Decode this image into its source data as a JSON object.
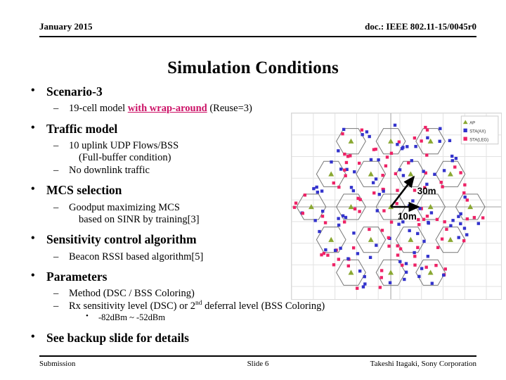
{
  "header": {
    "left": "January 2015",
    "right": "doc.: IEEE 802.11-15/0045r0"
  },
  "title": "Simulation Conditions",
  "bullets": {
    "scenario": {
      "heading": "Scenario-3",
      "sub_prefix": "19-cell model ",
      "sub_highlight": "with wrap-around",
      "sub_suffix": " (Reuse=3)"
    },
    "traffic": {
      "heading": "Traffic model",
      "sub1": "10 uplink UDP Flows/BSS",
      "sub1_cont": "(Full-buffer condition)",
      "sub2": "No downlink traffic"
    },
    "mcs": {
      "heading": "MCS selection",
      "sub1": "Goodput maximizing MCS",
      "sub1_cont": "based on SINR by training[3]"
    },
    "sensitivity": {
      "heading": "Sensitivity control algorithm",
      "sub1": "Beacon RSSI based algorithm[5]"
    },
    "parameters": {
      "heading": "Parameters",
      "sub1": "Method (DSC / BSS Coloring)",
      "sub2_a": "Rx sensitivity level (DSC) or 2",
      "sub2_sup": "nd",
      "sub2_b": " deferral level (BSS Coloring)",
      "sub3": "-82dBm ~ -52dBm"
    },
    "backup": {
      "heading": "See backup slide for details"
    }
  },
  "figure": {
    "annotations": {
      "arrow_diag_label": "30m",
      "arrow_horiz_label": "10m"
    },
    "legend": {
      "items": [
        {
          "label": "AP",
          "marker": "triangle",
          "color": "#8aa832"
        },
        {
          "label": "STA(AX)",
          "marker": "square",
          "color": "#3333cc"
        },
        {
          "label": "STA(LEG)",
          "marker": "square",
          "color": "#ee2266"
        }
      ]
    },
    "colors": {
      "ap": "#8aa832",
      "sta_ax": "#3333cc",
      "sta_leg": "#ee2266",
      "hexagon": "#777777",
      "grid": "#e2e2e2",
      "axis": "#a0a0a0"
    },
    "cell_count": 19,
    "hex_rows": [
      3,
      4,
      5,
      4,
      3
    ]
  },
  "footer": {
    "left": "Submission",
    "center": "Slide 6",
    "right": "Takeshi Itagaki, Sony Corporation"
  }
}
